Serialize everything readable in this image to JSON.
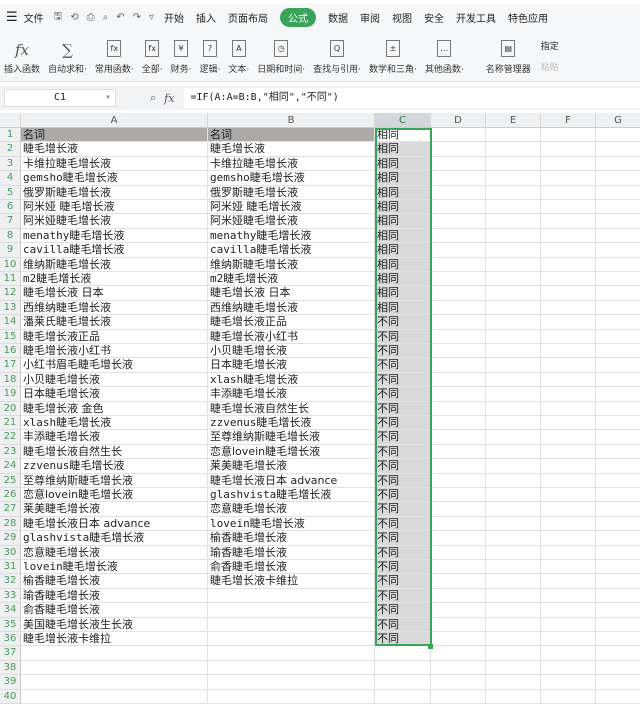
{
  "menu": {
    "items": [
      "文件",
      "开始",
      "插入",
      "页面布局",
      "公式",
      "数据",
      "审阅",
      "视图",
      "安全",
      "开发工具",
      "特色应用"
    ],
    "active": "公式"
  },
  "ribbon": {
    "items": [
      {
        "label": "插入函数",
        "icon": "fx"
      },
      {
        "label": "自动求和·",
        "icon": "∑"
      },
      {
        "label": "常用函数·",
        "icon": "fx"
      },
      {
        "label": "全部·",
        "icon": "fx"
      },
      {
        "label": "财务·",
        "icon": "¥"
      },
      {
        "label": "逻辑·",
        "icon": "?"
      },
      {
        "label": "文本·",
        "icon": "A"
      },
      {
        "label": "日期和时间·",
        "icon": "◷"
      },
      {
        "label": "查找与引用·",
        "icon": "Q"
      },
      {
        "label": "数学和三角·",
        "icon": "±"
      },
      {
        "label": "其他函数·",
        "icon": "…"
      },
      {
        "label": "名称管理器",
        "icon": "▤"
      }
    ],
    "side": [
      "指定",
      "粘贴"
    ]
  },
  "formula_bar": {
    "name_box": "C1",
    "fx": "fx",
    "formula": "=IF(A:A=B:B,\"相同\",\"不同\")"
  },
  "columns": [
    "A",
    "B",
    "C",
    "D",
    "E",
    "F",
    "G"
  ],
  "rows": [
    [
      "名词",
      "名词",
      "相同"
    ],
    [
      "睫毛增长液",
      "睫毛增长液",
      "相同"
    ],
    [
      "卡维拉睫毛增长液",
      "卡维拉睫毛增长液",
      "相同"
    ],
    [
      "gemsho睫毛增长液",
      "gemsho睫毛增长液",
      "相同"
    ],
    [
      "俄罗斯睫毛增长液",
      "俄罗斯睫毛增长液",
      "相同"
    ],
    [
      "阿米娅 睫毛增长液",
      "阿米娅 睫毛增长液",
      "相同"
    ],
    [
      "阿米娅睫毛增长液",
      "阿米娅睫毛增长液",
      "相同"
    ],
    [
      "menathy睫毛增长液",
      "menathy睫毛增长液",
      "相同"
    ],
    [
      "cavilla睫毛增长液",
      "cavilla睫毛增长液",
      "相同"
    ],
    [
      "维纳斯睫毛增长液",
      "维纳斯睫毛增长液",
      "相同"
    ],
    [
      "m2睫毛增长液",
      "m2睫毛增长液",
      "相同"
    ],
    [
      "睫毛增长液 日本",
      "睫毛增长液 日本",
      "相同"
    ],
    [
      "西维纳睫毛增长液",
      "西维纳睫毛增长液",
      "相同"
    ],
    [
      "潘莱氏睫毛增长液",
      "睫毛增长液正品",
      "不同"
    ],
    [
      "睫毛增长液正品",
      "睫毛增长液小红书",
      "不同"
    ],
    [
      "睫毛增长液小红书",
      "小贝睫毛增长液",
      "不同"
    ],
    [
      "小红书眉毛睫毛增长液",
      "日本睫毛增长液",
      "不同"
    ],
    [
      "小贝睫毛增长液",
      "xlash睫毛增长液",
      "不同"
    ],
    [
      "日本睫毛增长液",
      "丰添睫毛增长液",
      "不同"
    ],
    [
      "睫毛增长液 金色",
      "睫毛增长液自然生长",
      "不同"
    ],
    [
      "xlash睫毛增长液",
      "zzvenus睫毛增长液",
      "不同"
    ],
    [
      "丰添睫毛增长液",
      "至尊维纳斯睫毛增长液",
      "不同"
    ],
    [
      "睫毛增长液自然生长",
      "恋意lovein睫毛增长液",
      "不同"
    ],
    [
      "zzvenus睫毛增长液",
      "莱美睫毛增长液",
      "不同"
    ],
    [
      "至尊维纳斯睫毛增长液",
      "睫毛增长液日本 advance",
      "不同"
    ],
    [
      "恋意lovein睫毛增长液",
      "glashvista睫毛增长液",
      "不同"
    ],
    [
      "莱美睫毛增长液",
      "恋意睫毛增长液",
      "不同"
    ],
    [
      "睫毛增长液日本 advance",
      "lovein睫毛增长液",
      "不同"
    ],
    [
      "glashvista睫毛增长液",
      "榆香睫毛增长液",
      "不同"
    ],
    [
      "恋意睫毛增长液",
      "瑜香睫毛增长液",
      "不同"
    ],
    [
      "lovein睫毛增长液",
      "俞香睫毛增长液",
      "不同"
    ],
    [
      "榆香睫毛增长液",
      "睫毛增长液卡维拉",
      "不同"
    ],
    [
      "瑜香睫毛增长液",
      "",
      "不同"
    ],
    [
      "俞香睫毛增长液",
      "",
      "不同"
    ],
    [
      "美国睫毛增长液生长液",
      "",
      "不同"
    ],
    [
      "睫毛增长液卡维拉",
      "",
      "不同"
    ],
    [
      "",
      "",
      ""
    ],
    [
      "",
      "",
      ""
    ],
    [
      "",
      "",
      ""
    ],
    [
      "",
      "",
      ""
    ]
  ],
  "colors": {
    "accent": "#3aa35a",
    "header_fill": "#aca9a9",
    "selection_fill": "#d9d9d9"
  }
}
